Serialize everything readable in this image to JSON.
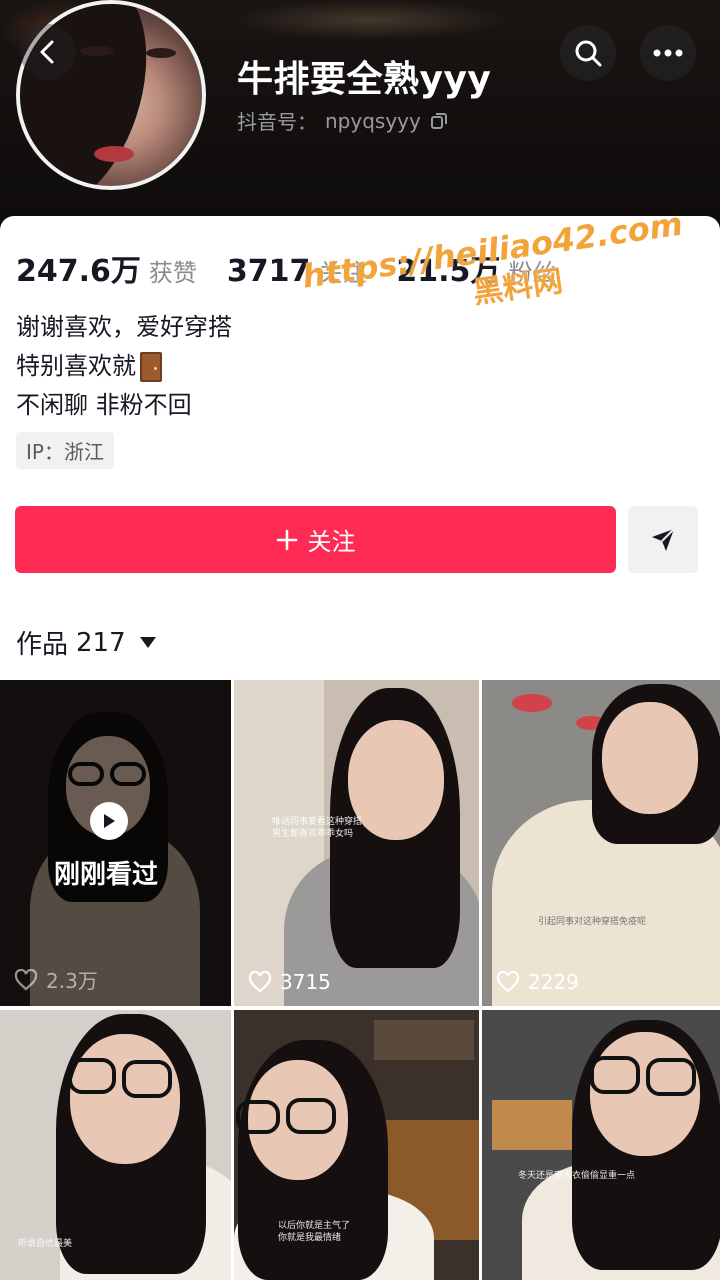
{
  "header": {
    "nickname": "牛排要全熟yyy",
    "douyin_id_label": "抖音号：",
    "douyin_id": "npyqsyyy",
    "icons": {
      "back": "back-arrow-icon",
      "search": "search-icon",
      "more": "more-dots-icon",
      "copy": "copy-icon"
    }
  },
  "stats": [
    {
      "value": "247.6万",
      "label": "获赞"
    },
    {
      "value": "3717",
      "label": "关注"
    },
    {
      "value": "21.5万",
      "label": "粉丝"
    }
  ],
  "watermark": {
    "url": "https://heiliao42.com",
    "name": "黑料网"
  },
  "bio": {
    "line1": "谢谢喜欢，爱好穿搭",
    "line2": "特别喜欢就",
    "line2_emoji": "door-emoji",
    "line3": "不闲聊 非粉不回"
  },
  "ip": "IP：浙江",
  "actions": {
    "follow_label": "关注",
    "follow_icon": "plus-icon",
    "share_icon": "send-icon"
  },
  "works": {
    "label": "作品",
    "count": "217"
  },
  "videos": [
    {
      "likes": "2.3万",
      "recently_viewed": "刚刚看过"
    },
    {
      "likes": "3715",
      "caption": "唯话同事爱看这种穿搭\n男生都喜欢乖乖女吗"
    },
    {
      "likes": "2229",
      "caption": "引起同事对这种穿搭免疫呢"
    },
    {
      "likes": "",
      "caption": "听说自信最美"
    },
    {
      "likes": "",
      "caption": "以后你就是主气了\n你就是我最情绪"
    },
    {
      "likes": "",
      "caption": "冬天还是穿大衣偷偷显重一点"
    }
  ],
  "colors": {
    "accent": "#fe2c55",
    "watermark": "#f2a33a"
  }
}
